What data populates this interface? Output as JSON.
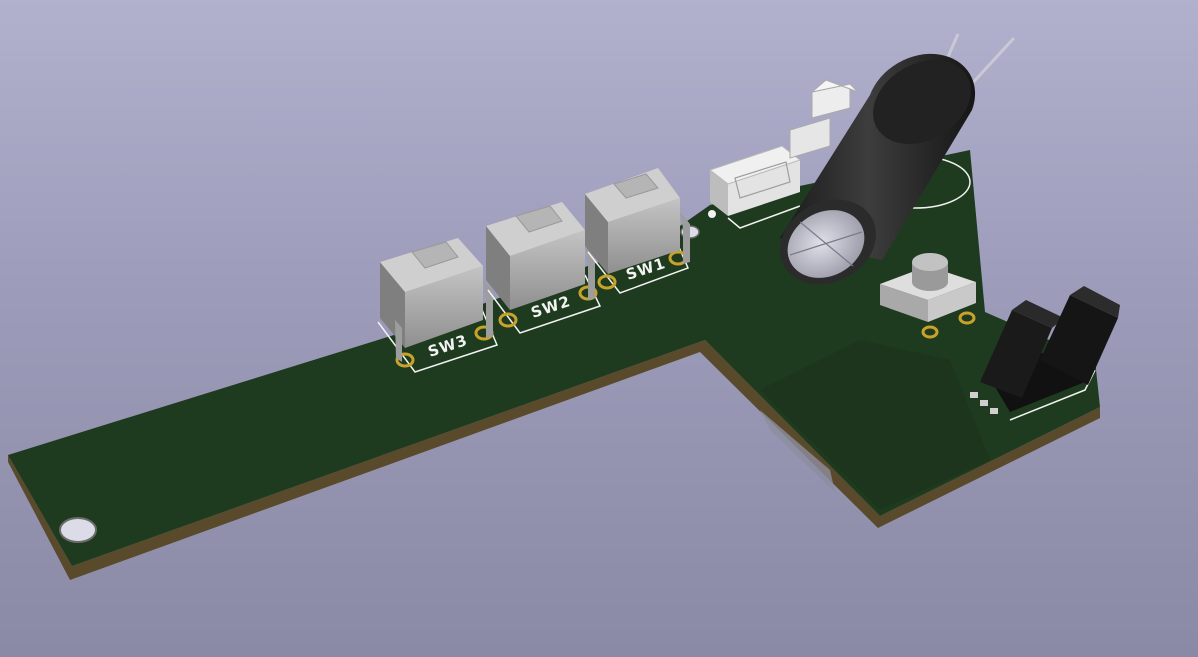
{
  "viewer": {
    "background_top": "#b1b1ce",
    "background_bottom": "#8a8aa6"
  },
  "board": {
    "solder_mask_color": "#1f3b1f",
    "edge_color": "#5a4a2c",
    "silkscreen_color": "#f2f2f2",
    "pad_color": "#c8a22a"
  },
  "components": {
    "sw1": {
      "ref": "SW1",
      "type": "tactile-switch-right-angle"
    },
    "sw2": {
      "ref": "SW2",
      "type": "tactile-switch-right-angle"
    },
    "sw3": {
      "ref": "SW3",
      "type": "tactile-switch-right-angle"
    },
    "capacitor": {
      "type": "electrolytic-capacitor",
      "body_color": "#2a2a2a"
    },
    "connectors": [
      "jst-connector",
      "jst-connector-right-angle"
    ],
    "pushbutton": {
      "type": "tactile-pushbutton"
    },
    "sensor": {
      "type": "slotted-optical-sensor",
      "body_color": "#111111"
    }
  }
}
